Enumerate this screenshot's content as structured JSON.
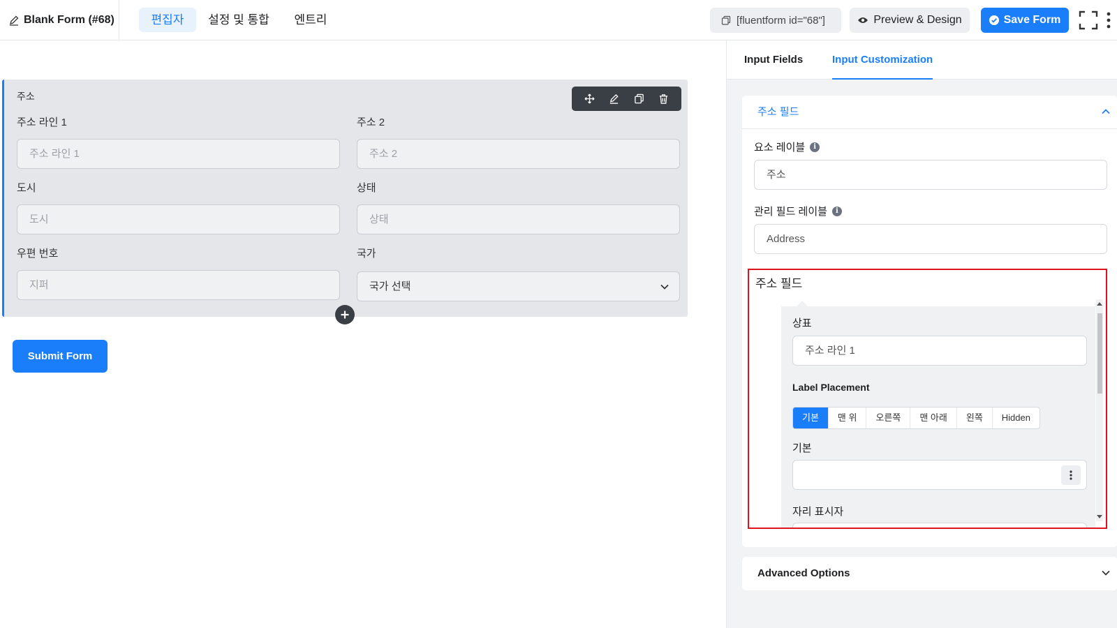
{
  "topbar": {
    "form_title": "Blank Form (#68)",
    "tabs": [
      {
        "label": "편집자",
        "active": true
      },
      {
        "label": "설정 및 통합",
        "active": false
      },
      {
        "label": "엔트리",
        "active": false
      }
    ],
    "shortcode": "[fluentform id=\"68\"]",
    "preview_label": "Preview & Design",
    "save_label": "Save Form"
  },
  "editor": {
    "address_title": "주소",
    "fields": [
      {
        "label": "주소 라인 1",
        "placeholder": "주소 라인 1"
      },
      {
        "label": "주소 2",
        "placeholder": "주소 2"
      },
      {
        "label": "도시",
        "placeholder": "도시"
      },
      {
        "label": "상태",
        "placeholder": "상태"
      },
      {
        "label": "우편 번호",
        "placeholder": "지퍼"
      },
      {
        "label": "국가",
        "placeholder": "국가 선택"
      }
    ],
    "submit_label": "Submit Form"
  },
  "sidebar": {
    "tabs": [
      {
        "label": "Input Fields",
        "active": false
      },
      {
        "label": "Input Customization",
        "active": true
      }
    ],
    "panel_title": "주소 필드",
    "element_label_caption": "요소 레이블",
    "element_label_value": "주소",
    "admin_label_caption": "관리 필드 레이블",
    "admin_label_value": "Address",
    "address_fields_heading": "주소 필드",
    "sub": {
      "label_caption": "상표",
      "label_value": "주소 라인 1",
      "placement_caption": "Label Placement",
      "placement_options": [
        "기본",
        "맨 위",
        "오른쪽",
        "맨 아래",
        "왼쪽",
        "Hidden"
      ],
      "placement_selected": "기본",
      "default_caption": "기본",
      "default_value": "",
      "placeholder_caption": "자리 표시자"
    },
    "advanced_label": "Advanced Options"
  },
  "colors": {
    "accent": "#1a7efb",
    "highlight_border": "#e0131c",
    "dark_toolbar": "#3a3e45"
  }
}
